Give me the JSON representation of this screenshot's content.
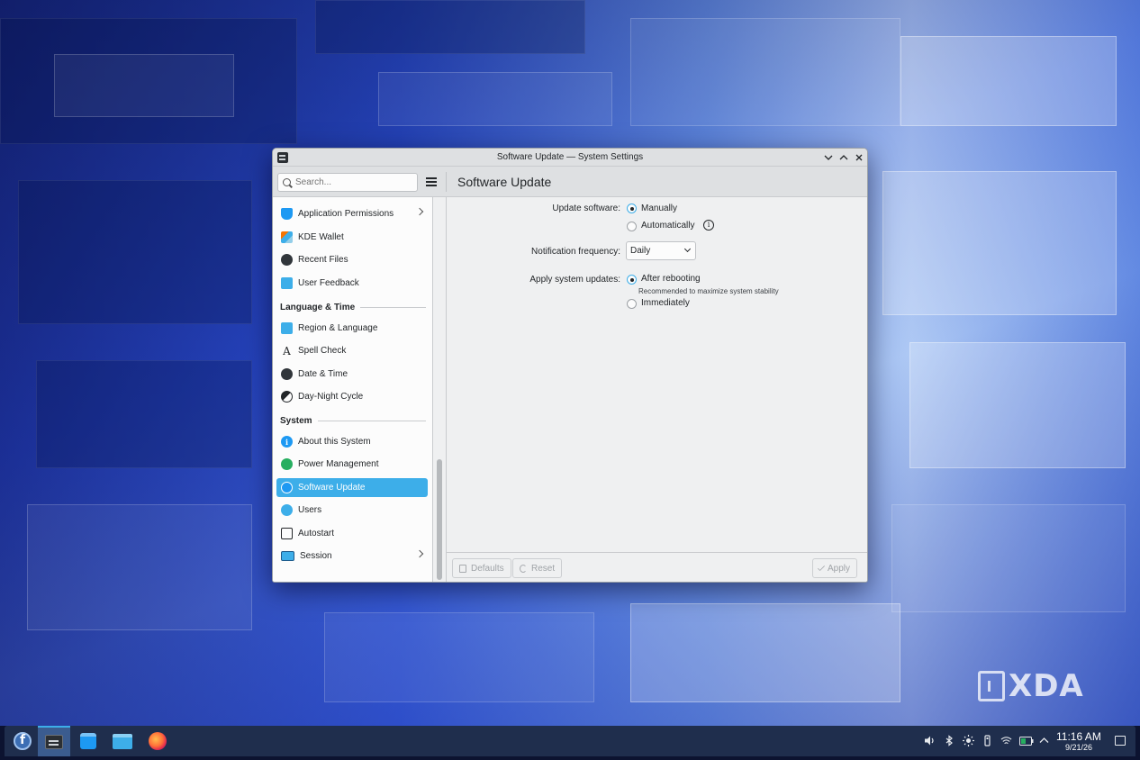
{
  "window": {
    "title": "Software Update — System Settings",
    "page_title": "Software Update"
  },
  "search": {
    "placeholder": "Search..."
  },
  "sidebar": {
    "items": [
      {
        "label": "Application Permissions",
        "icon": "shield-icon",
        "has_children": true
      },
      {
        "label": "KDE Wallet",
        "icon": "wallet-icon"
      },
      {
        "label": "Recent Files",
        "icon": "clock-icon"
      },
      {
        "label": "User Feedback",
        "icon": "feedback-icon"
      }
    ],
    "categories": {
      "language_time": {
        "label": "Language & Time",
        "items": [
          {
            "label": "Region & Language",
            "icon": "region-icon"
          },
          {
            "label": "Spell Check",
            "icon": "spell-check-icon",
            "glyph": "A"
          },
          {
            "label": "Date & Time",
            "icon": "clock-icon"
          },
          {
            "label": "Day-Night Cycle",
            "icon": "day-night-icon"
          }
        ]
      },
      "system": {
        "label": "System",
        "items": [
          {
            "label": "About this System",
            "icon": "info-icon",
            "glyph": "i"
          },
          {
            "label": "Power Management",
            "icon": "power-icon"
          },
          {
            "label": "Software Update",
            "icon": "update-icon",
            "active": true
          },
          {
            "label": "Users",
            "icon": "users-icon"
          },
          {
            "label": "Autostart",
            "icon": "autostart-icon"
          },
          {
            "label": "Session",
            "icon": "session-icon",
            "has_children": true
          }
        ]
      }
    }
  },
  "content": {
    "update_software": {
      "label": "Update software:",
      "options": [
        "Manually",
        "Automatically"
      ],
      "selected": "Manually"
    },
    "notification_frequency": {
      "label": "Notification frequency:",
      "value": "Daily"
    },
    "apply_updates": {
      "label": "Apply system updates:",
      "options": [
        "After rebooting",
        "Immediately"
      ],
      "selected": "After rebooting",
      "hint": "Recommended to maximize system stability"
    }
  },
  "footer": {
    "defaults": "Defaults",
    "reset": "Reset",
    "apply": "Apply"
  },
  "taskbar": {
    "clock_time": "11:16 AM",
    "clock_date": "9/21/26"
  },
  "watermark": "XDA",
  "colors": {
    "accent": "#3daee9",
    "window_bg": "#eff0f1",
    "taskbar": "#1f2e4d"
  }
}
